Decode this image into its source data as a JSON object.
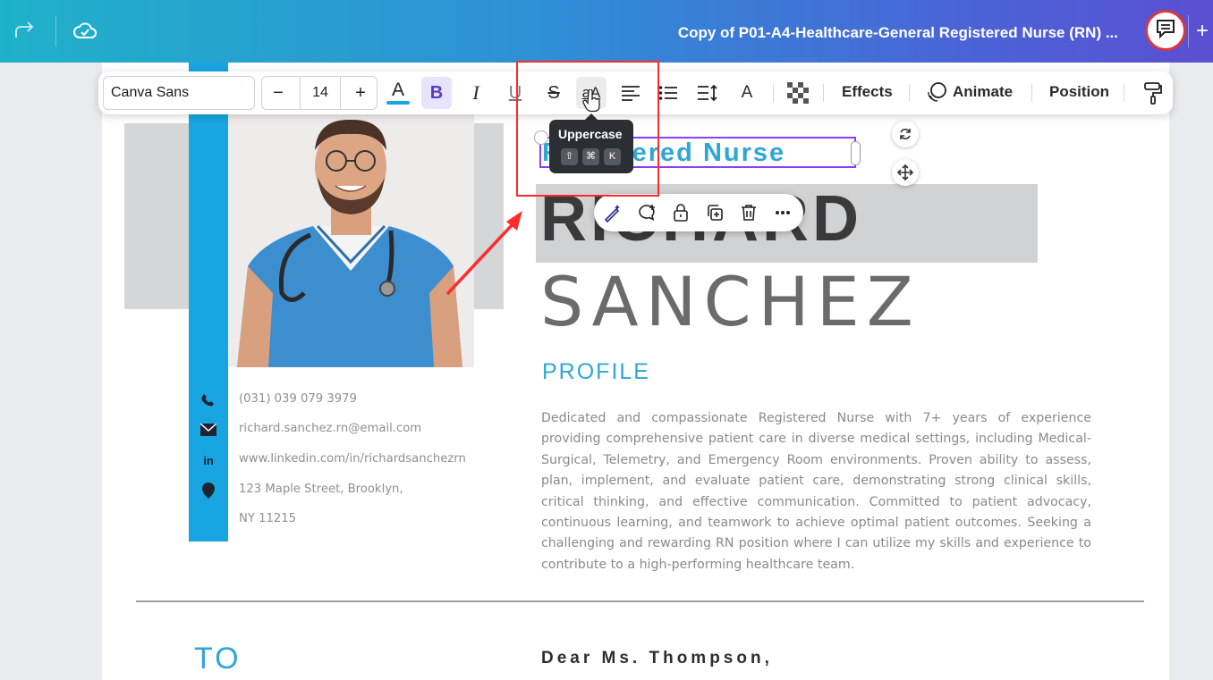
{
  "topbar": {
    "doc_title": "Copy of P01-A4-Healthcare-General Registered Nurse (RN) ...",
    "icons": [
      "redo-icon",
      "cloud-saved-icon",
      "comment-icon",
      "plus-icon"
    ]
  },
  "toolbar": {
    "font_name": "Canva Sans",
    "font_size": "14",
    "size_minus": "−",
    "size_plus": "+",
    "bold_label": "B",
    "italic_label": "I",
    "underline_label": "U",
    "strike_label": "S",
    "case_label": "aA",
    "text_color_label": "A",
    "spacing_label": "A",
    "effects_label": "Effects",
    "animate_label": "Animate",
    "position_label": "Position",
    "accent_color": "#18a5e1"
  },
  "tooltip": {
    "label": "Uppercase",
    "keys": [
      "⇧",
      "⌘",
      "K"
    ]
  },
  "resume": {
    "title_line": "Registered Nurse",
    "first_name": "RICHARD",
    "last_name": "SANCHEZ",
    "profile_heading": "PROFILE",
    "profile_text": "Dedicated and compassionate Registered Nurse with 7+ years of experience providing comprehensive patient care in diverse medical settings, including Medical-Surgical, Telemetry, and Emergency Room environments. Proven ability to assess, plan, implement, and evaluate patient care, demonstrating strong clinical skills, critical thinking, and effective communication. Committed to patient advocacy, continuous learning, and teamwork to achieve optimal patient outcomes. Seeking a challenging and rewarding RN position where I can utilize my skills and experience to contribute to a high-performing healthcare team.",
    "contact": {
      "phone": "(031) 039 079 3979",
      "email": "richard.sanchez.rn@email.com",
      "linkedin_icon": "in",
      "linkedin": "www.linkedin.com/in/richardsanchezrn",
      "address_line1": "123 Maple Street, Brooklyn,",
      "address_line2": "NY 11215"
    },
    "to_heading": "TO",
    "salutation": "Dear Ms. Thompson,"
  },
  "colors": {
    "brand_blue": "#18a5e1",
    "heading_blue": "#2fa6d6",
    "selection_purple": "#8b3dff",
    "annotation_red": "#ff2a2a"
  }
}
